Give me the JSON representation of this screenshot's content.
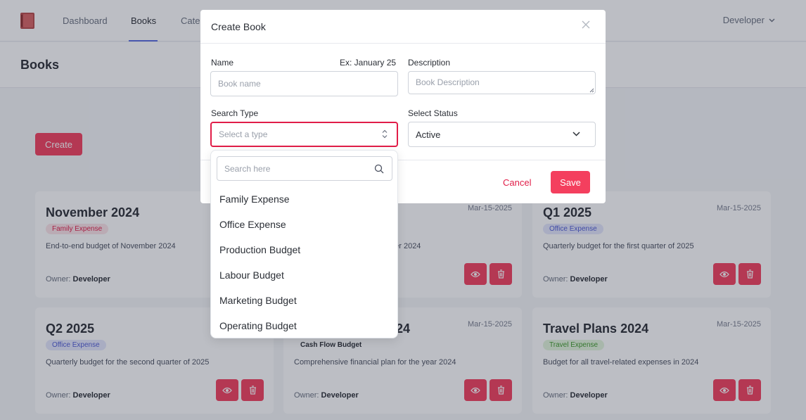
{
  "nav": {
    "items": [
      {
        "label": "Dashboard"
      },
      {
        "label": "Books"
      },
      {
        "label": "Cate"
      }
    ],
    "user": "Developer"
  },
  "page": {
    "title": "Books",
    "create_label": "Create"
  },
  "cards": [
    {
      "title": "November 2024",
      "date": "",
      "badge": "Family Expense",
      "desc": "End-to-end budget of November 2024",
      "owner_label": "Owner:",
      "owner": "Developer"
    },
    {
      "title": "",
      "date": "Mar-15-2025",
      "badge": "",
      "desc": "ber 2024",
      "owner_label": "",
      "owner": ""
    },
    {
      "title": "Q1 2025",
      "date": "Mar-15-2025",
      "badge": "Office Expense",
      "desc": "Quarterly budget for the first quarter of 2025",
      "owner_label": "Owner:",
      "owner": "Developer"
    },
    {
      "title": "Q2 2025",
      "date": "",
      "badge": "Office Expense",
      "desc": "Quarterly budget for the second quarter of 2025",
      "owner_label": "Owner:",
      "owner": "Developer"
    },
    {
      "title": "24",
      "date": "Mar-15-2025",
      "badge": "Cash Flow Budget",
      "desc": "Comprehensive financial plan for the year 2024",
      "owner_label": "Owner:",
      "owner": "Developer"
    },
    {
      "title": "Travel Plans 2024",
      "date": "Mar-15-2025",
      "badge": "Travel Expense",
      "desc": "Budget for all travel-related expenses in 2024",
      "owner_label": "Owner:",
      "owner": "Developer"
    }
  ],
  "modal": {
    "title": "Create Book",
    "name_label": "Name",
    "name_hint": "Ex: January 25",
    "name_placeholder": "Book name",
    "description_label": "Description",
    "description_placeholder": "Book Description",
    "search_type_label": "Search Type",
    "search_type_placeholder": "Select a type",
    "status_label": "Select Status",
    "status_value": "Active",
    "cancel_label": "Cancel",
    "save_label": "Save"
  },
  "dropdown": {
    "search_placeholder": "Search here",
    "options": [
      "Family Expense",
      "Office Expense",
      "Production Budget",
      "Labour Budget",
      "Marketing Budget",
      "Operating Budget"
    ]
  },
  "colors": {
    "accent": "#f43f5e",
    "nav_active_underline": "#5b6ee1"
  },
  "icons": [
    "notebook-icon",
    "chevron-down-icon",
    "close-icon",
    "chevron-up-down-icon",
    "search-icon",
    "eye-icon",
    "trash-icon"
  ]
}
